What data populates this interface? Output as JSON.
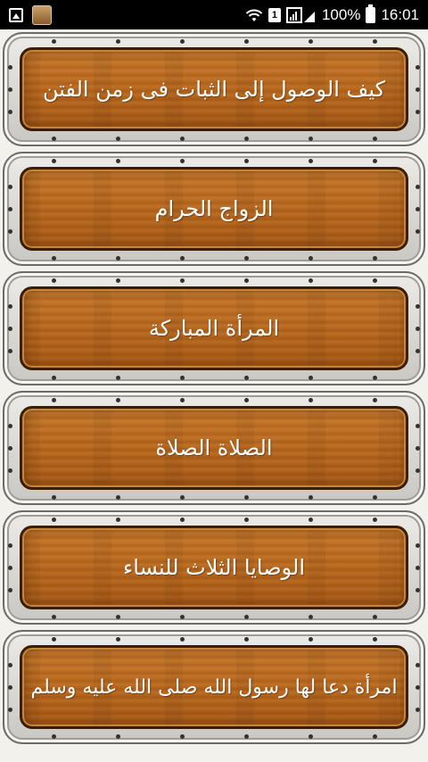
{
  "status_bar": {
    "sim": "1",
    "battery": "100%",
    "time": "16:01",
    "icons": [
      "image-icon",
      "app-icon",
      "wifi-icon",
      "sim-icon",
      "signal-icon",
      "battery-icon"
    ]
  },
  "items": [
    {
      "label": "كيف الوصول إلى الثبات فى زمن الفتن"
    },
    {
      "label": "الزواج الحرام"
    },
    {
      "label": "المرأة المباركة"
    },
    {
      "label": "الصلاة الصلاة"
    },
    {
      "label": "الوصايا الثلاث للنساء"
    },
    {
      "label": "امرأة دعا لها رسول الله صلى الله عليه وسلم"
    }
  ],
  "colors": {
    "wood": "#b5651c",
    "wood_border": "#3a1d05",
    "metal_frame": "#d9d7d2",
    "text": "#ffffff"
  }
}
